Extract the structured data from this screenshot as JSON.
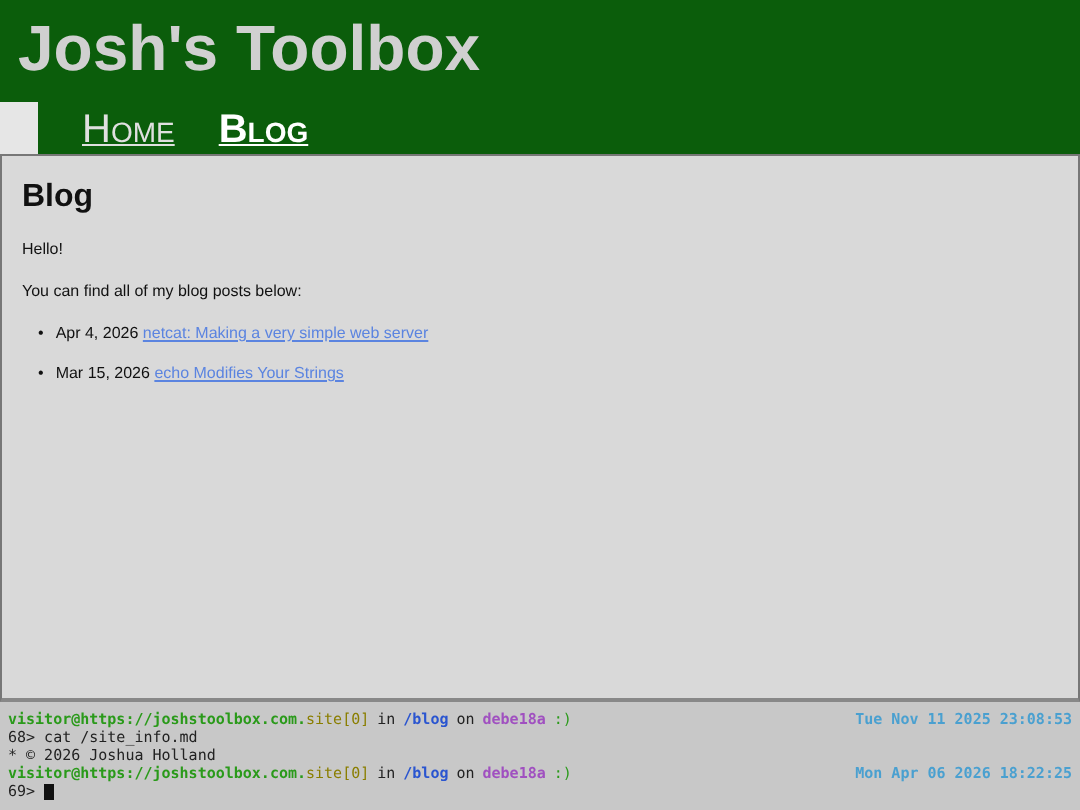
{
  "header": {
    "title": "Josh's Toolbox"
  },
  "nav": {
    "items": [
      {
        "label": "Home",
        "selected": false
      },
      {
        "label": "Blog",
        "selected": true
      }
    ]
  },
  "main": {
    "heading": "Blog",
    "paragraphs": [
      "Hello!",
      "You can find all of my blog posts below:"
    ],
    "posts": [
      {
        "bullet": "•",
        "date": "Apr 4, 2026",
        "title": "netcat: Making a very simple web server"
      },
      {
        "bullet": "•",
        "date": "Mar 15, 2026",
        "title": "echo Modifies Your Strings"
      }
    ]
  },
  "terminal": {
    "lines": [
      {
        "kind": "prompt",
        "user_host": "visitor@https://joshstoolbox.com.",
        "site": "site[0]",
        "in": "in",
        "path": "/blog",
        "on": "on",
        "branch": "debe18a",
        "mood": ":)",
        "time": "Tue Nov 11 2025 23:08:53"
      },
      {
        "kind": "command",
        "number": "68>",
        "text": "cat /site_info.md"
      },
      {
        "kind": "output",
        "text": "* © 2026 Joshua Holland"
      },
      {
        "kind": "prompt",
        "user_host": "visitor@https://joshstoolbox.com.",
        "site": "site[0]",
        "in": "in",
        "path": "/blog",
        "on": "on",
        "branch": "debe18a",
        "mood": ":)",
        "time": "Mon Apr 06 2026 18:22:25"
      },
      {
        "kind": "input",
        "number": "69>"
      }
    ]
  }
}
